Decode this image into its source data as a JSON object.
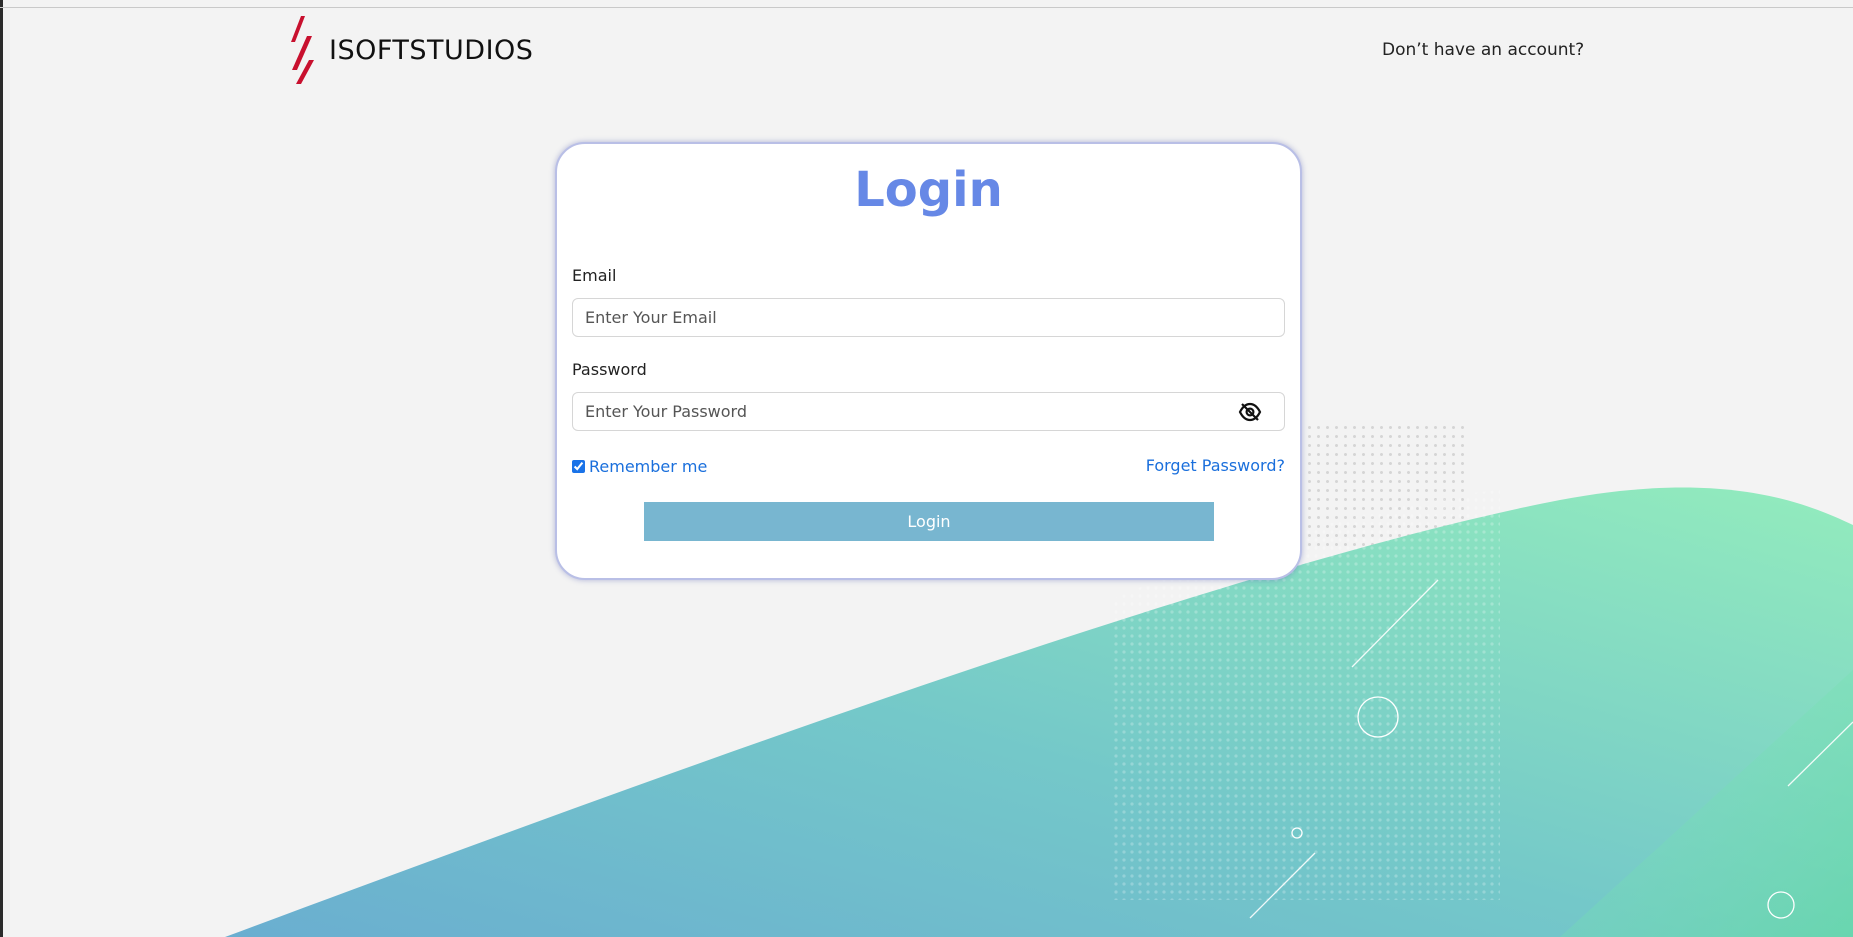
{
  "brand": {
    "name": "ISOFTSTUDIOS",
    "logo_icon": "isoftstudios-logo-icon"
  },
  "header": {
    "signup_link": "Don’t have an account?"
  },
  "login_form": {
    "title": "Login",
    "email_label": "Email",
    "email_placeholder": "Enter Your Email",
    "email_value": "",
    "password_label": "Password",
    "password_placeholder": "Enter Your Password",
    "password_value": "",
    "password_toggle_icon": "eye-off-icon",
    "remember_label": "Remember me",
    "remember_checked": true,
    "forgot_link": "Forget Password?",
    "submit_label": "Login"
  },
  "colors": {
    "background": "#f3f3f3",
    "title": "#6688e6",
    "link": "#1a6fdc",
    "button": "#78b6d0",
    "logo_red": "#c8102e",
    "wave_start": "#6fb3cf",
    "wave_end": "#8de8bb"
  }
}
